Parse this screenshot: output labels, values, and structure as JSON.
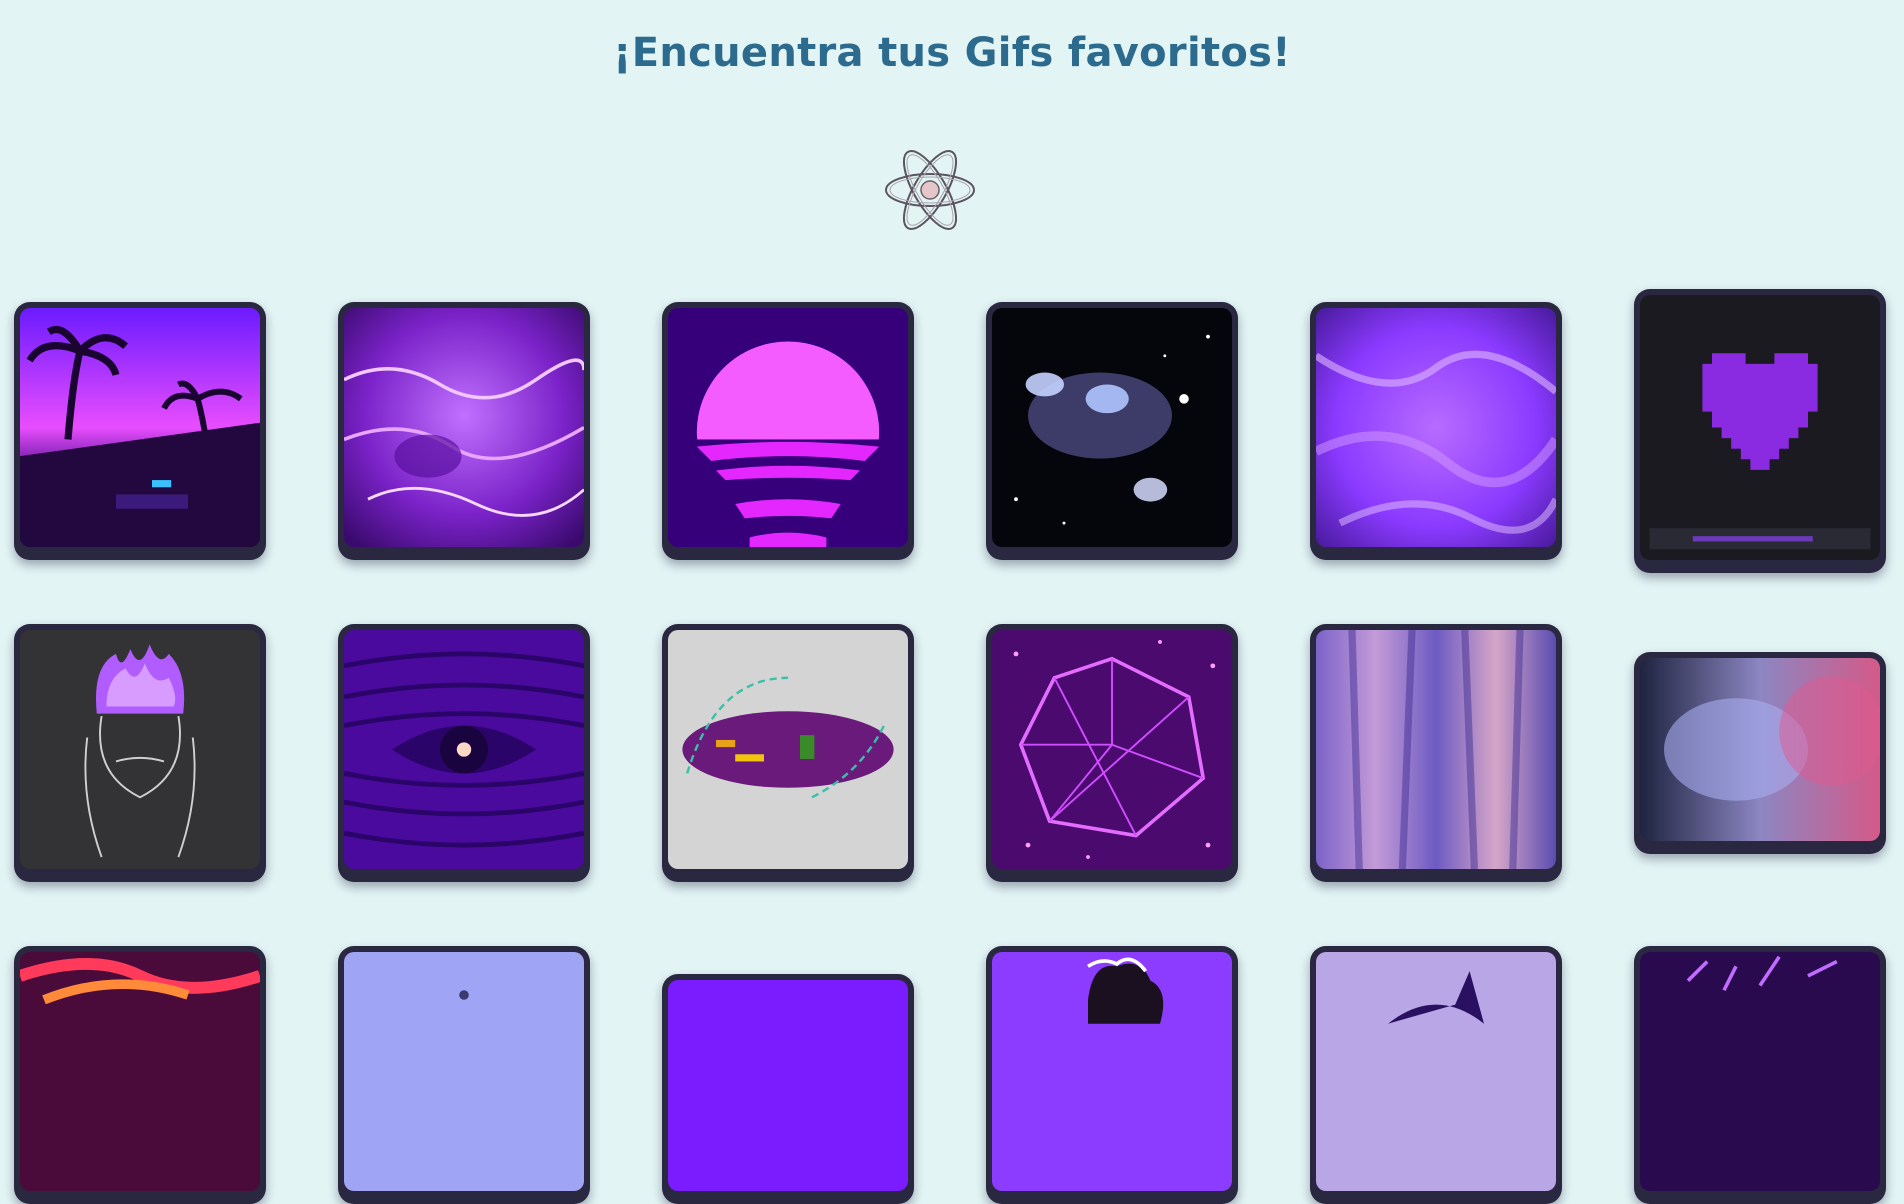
{
  "header": {
    "title": "¡Encuentra tus Gifs favoritos!"
  },
  "logo": {
    "icon": "atom-icon"
  },
  "gallery": {
    "items": [
      {
        "name": "gif-palm-sunset"
      },
      {
        "name": "gif-purple-water"
      },
      {
        "name": "gif-synth-sun"
      },
      {
        "name": "gif-galaxy"
      },
      {
        "name": "gif-purple-smoke"
      },
      {
        "name": "gif-pixel-heart"
      },
      {
        "name": "gif-burning-head"
      },
      {
        "name": "gif-eye-waves"
      },
      {
        "name": "gif-glitch"
      },
      {
        "name": "gif-neon-polyhedron"
      },
      {
        "name": "gif-purple-streaks"
      },
      {
        "name": "gif-pink-smoke"
      },
      {
        "name": "gif-neon-swirl"
      },
      {
        "name": "gif-lavender-figure"
      },
      {
        "name": "gif-violet"
      },
      {
        "name": "gif-silhouette-hair"
      },
      {
        "name": "gif-cat-ears"
      },
      {
        "name": "gif-sparkles"
      }
    ]
  }
}
